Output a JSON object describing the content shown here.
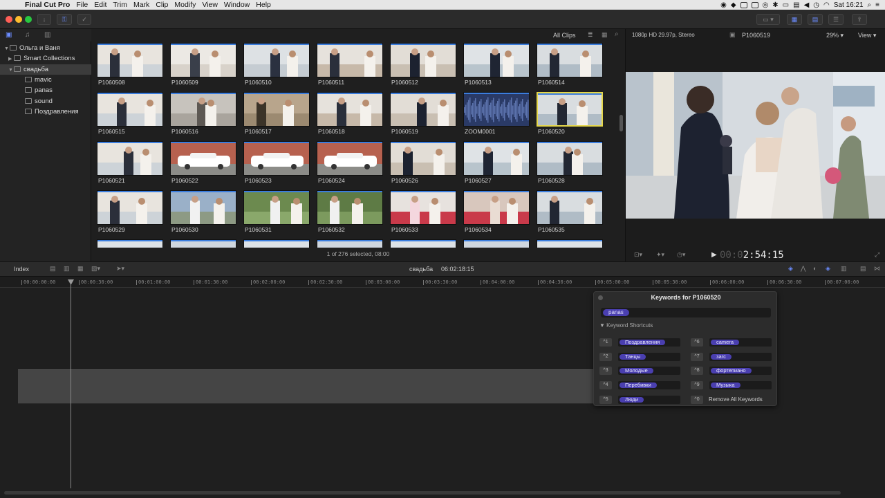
{
  "menubar": {
    "app": "Final Cut Pro",
    "items": [
      "File",
      "Edit",
      "Trim",
      "Mark",
      "Clip",
      "Modify",
      "View",
      "Window",
      "Help"
    ],
    "clock": "Sat 16:21"
  },
  "library": {
    "items": [
      {
        "label": "Ольга и Ваня",
        "selected": false,
        "indent": 0,
        "tri": "▼"
      },
      {
        "label": "Smart Collections",
        "selected": false,
        "indent": 1,
        "tri": "▶"
      },
      {
        "label": "свадьба",
        "selected": true,
        "indent": 1,
        "tri": "▼"
      },
      {
        "label": "mavic",
        "selected": false,
        "indent": 2,
        "tri": ""
      },
      {
        "label": "panas",
        "selected": false,
        "indent": 2,
        "tri": ""
      },
      {
        "label": "sound",
        "selected": false,
        "indent": 2,
        "tri": ""
      },
      {
        "label": "Поздравления",
        "selected": false,
        "indent": 2,
        "tri": ""
      }
    ]
  },
  "browser": {
    "filter": "All Clips",
    "status": "1 of 276 selected, 08:00",
    "clips": [
      "P1060508",
      "P1060509",
      "P1060510",
      "P1060511",
      "P1060512",
      "P1060513",
      "P1060514",
      "P1060515",
      "P1060516",
      "P1060517",
      "P1060518",
      "P1060519",
      "ZOOM0001",
      "P1060520",
      "P1060521",
      "P1060522",
      "P1060523",
      "P1060524",
      "P1060526",
      "P1060527",
      "P1060528",
      "P1060529",
      "P1060530",
      "P1060531",
      "P1060532",
      "P1060533",
      "P1060534",
      "P1060535"
    ],
    "selected_clip": "P1060520"
  },
  "viewer": {
    "format": "1080p HD 29.97p, Stereo",
    "clip_name": "P1060519",
    "zoom": "29%",
    "view_label": "View",
    "timecode_dim": "00:0",
    "timecode": "2:54:15"
  },
  "timeline": {
    "index_label": "Index",
    "name": "свадьба",
    "duration": "06:02:18:15",
    "ticks": [
      "00:00:00:00",
      "00:00:30:00",
      "00:01:00:00",
      "00:01:30:00",
      "00:02:00:00",
      "00:02:30:00",
      "00:03:00:00",
      "00:03:30:00",
      "00:04:00:00",
      "00:04:30:00",
      "00:05:00:00",
      "00:05:30:00",
      "00:06:00:00",
      "00:06:30:00",
      "00:07:00:00"
    ]
  },
  "keywords": {
    "title": "Keywords for P1060520",
    "current_tag": "panas",
    "shortcuts_label": "Keyword Shortcuts",
    "shortcuts": [
      {
        "key": "^1",
        "label": "Поздравления"
      },
      {
        "key": "^2",
        "label": "Танцы"
      },
      {
        "key": "^3",
        "label": "Молодые"
      },
      {
        "key": "^4",
        "label": "Перебивки"
      },
      {
        "key": "^5",
        "label": "Люди"
      },
      {
        "key": "^6",
        "label": "camera"
      },
      {
        "key": "^7",
        "label": "загс"
      },
      {
        "key": "^8",
        "label": "фортепиано"
      },
      {
        "key": "^9",
        "label": "Музыка"
      },
      {
        "key": "^0",
        "label": "Remove All Keywords"
      }
    ]
  }
}
